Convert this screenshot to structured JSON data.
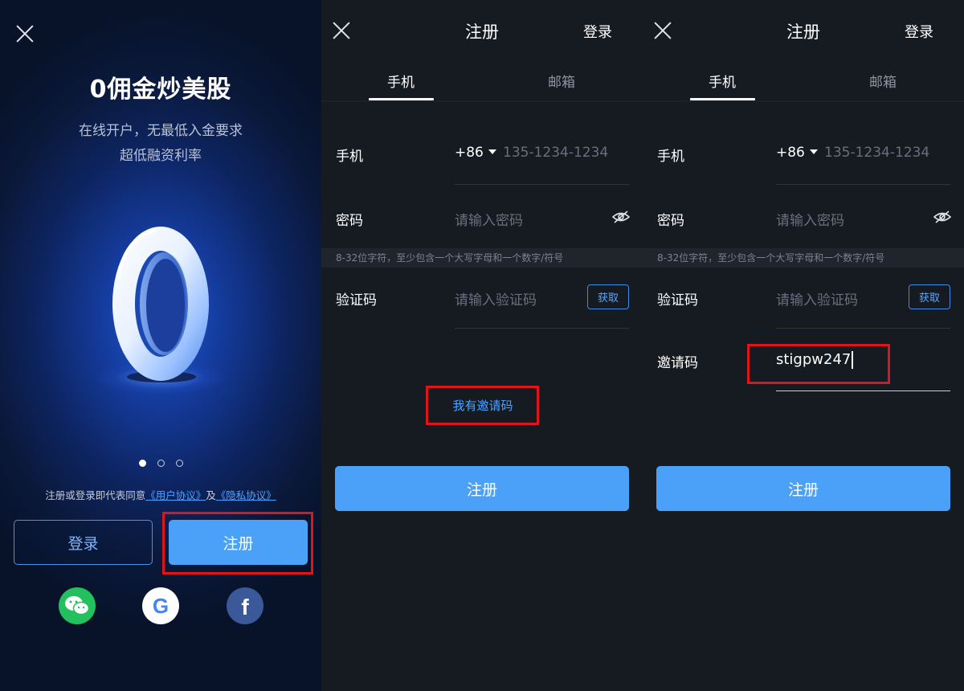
{
  "panel1": {
    "title": "0佣金炒美股",
    "subtitle_line1": "在线开户，无最低入金要求",
    "subtitle_line2": "超低融资利率",
    "hero_glyph": "0",
    "agreement_prefix": "注册或登录即代表同意",
    "user_agreement": "《用户协议》",
    "agreement_and": "及",
    "privacy_policy": "《隐私协议》",
    "login_button": "登录",
    "register_button": "注册",
    "carousel_total": 3,
    "carousel_active": 0,
    "social_icons": [
      "wechat-icon",
      "google-icon",
      "facebook-icon"
    ],
    "social_letters": {
      "google": "G",
      "facebook": "f"
    }
  },
  "register": {
    "header_title": "注册",
    "header_login": "登录",
    "tab_phone": "手机",
    "tab_email": "邮箱",
    "phone_label": "手机",
    "country_code": "+86",
    "phone_placeholder": "135-1234-1234",
    "password_label": "密码",
    "password_placeholder": "请输入密码",
    "password_hint": "8-32位字符，至少包含一个大写字母和一个数字/符号",
    "code_label": "验证码",
    "code_placeholder": "请输入验证码",
    "get_code_button": "获取",
    "have_invite_code": "我有邀请码",
    "invite_label": "邀请码",
    "invite_value": "stigpw247",
    "submit_button": "注册"
  },
  "colors": {
    "accent": "#4ba0f7",
    "link": "#4ba3ff",
    "highlight_box": "#e0141b",
    "panel_bg": "#161a21"
  }
}
